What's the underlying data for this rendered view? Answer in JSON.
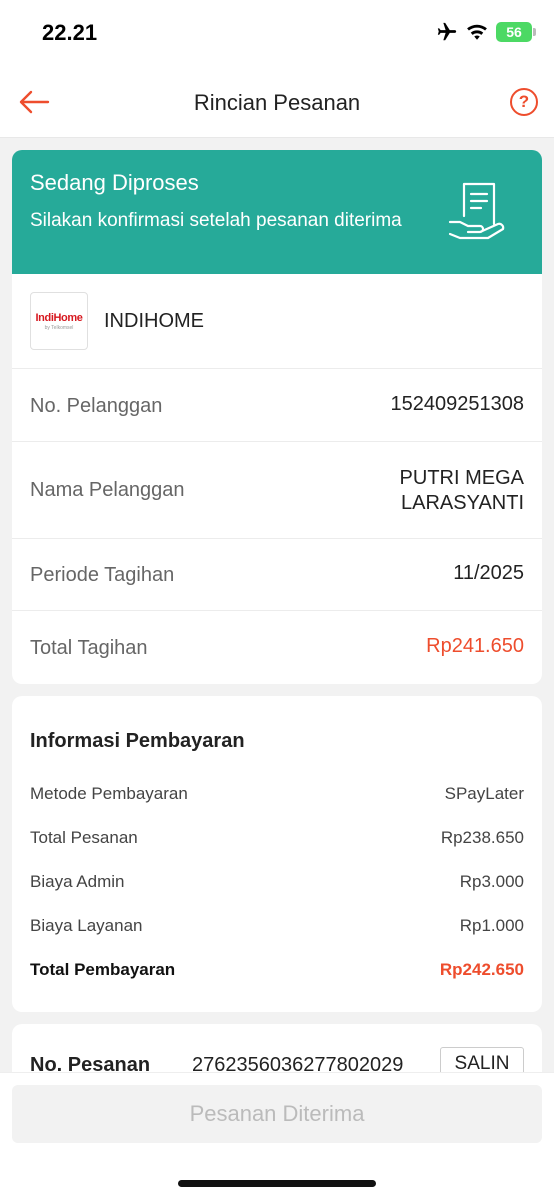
{
  "status_bar": {
    "time": "22.21",
    "battery": "56"
  },
  "header": {
    "title": "Rincian Pesanan"
  },
  "status": {
    "title": "Sedang Diproses",
    "description": "Silakan konfirmasi setelah pesanan diterima"
  },
  "merchant": {
    "logo_text": "IndiHome",
    "logo_sub": "by Telkomsel",
    "name": "INDIHOME"
  },
  "bill": {
    "customer_no_label": "No. Pelanggan",
    "customer_no": "152409251308",
    "customer_name_label": "Nama Pelanggan",
    "customer_name_line1": "PUTRI MEGA",
    "customer_name_line2": "LARASYANTI",
    "period_label": "Periode Tagihan",
    "period": "11/2025",
    "total_label": "Total Tagihan",
    "total": "Rp241.650"
  },
  "payment": {
    "title": "Informasi Pembayaran",
    "method_label": "Metode Pembayaran",
    "method": "SPayLater",
    "order_total_label": "Total Pesanan",
    "order_total": "Rp238.650",
    "admin_label": "Biaya Admin",
    "admin": "Rp3.000",
    "service_label": "Biaya Layanan",
    "service": "Rp1.000",
    "payment_total_label": "Total Pembayaran",
    "payment_total": "Rp242.650"
  },
  "order": {
    "label": "No. Pesanan",
    "number": "2762356036277802029",
    "copy_label": "SALIN"
  },
  "footer": {
    "button_label": "Pesanan Diterima"
  },
  "colors": {
    "accent": "#ee4d2d",
    "status_bg": "#26aa99"
  },
  "icons": {
    "back": "arrow-left-icon",
    "help": "question-circle-icon",
    "status": "receipt-hand-icon"
  }
}
